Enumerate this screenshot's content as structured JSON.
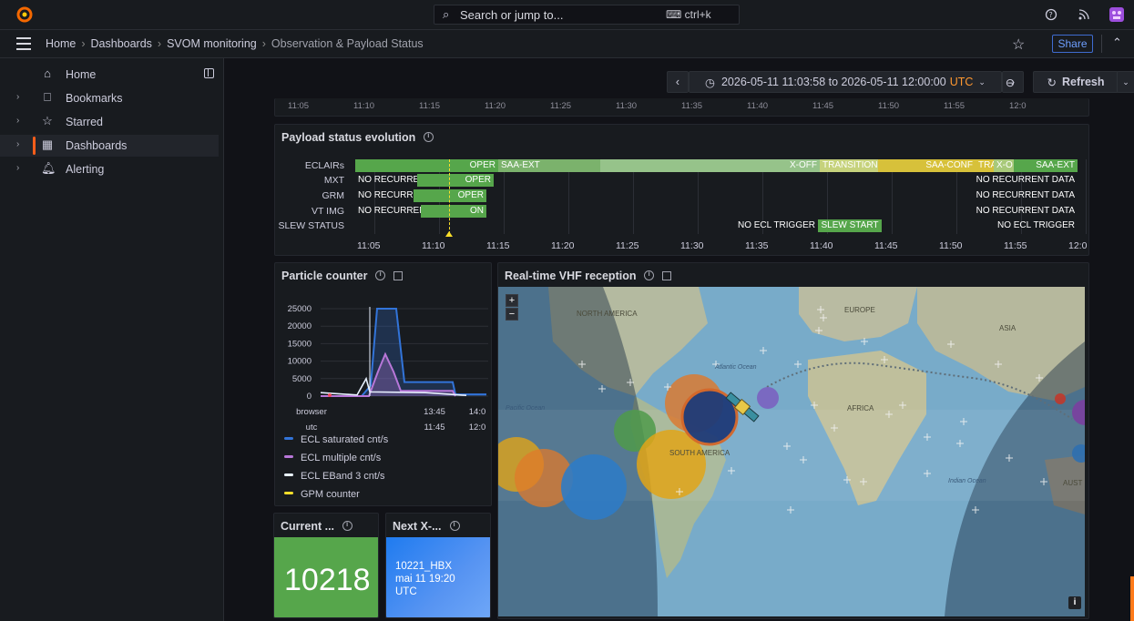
{
  "topbar": {
    "search_placeholder": "Search or jump to...",
    "search_shortcut": "ctrl+k",
    "icons": [
      "grafana-logo",
      "help-icon",
      "rss-icon",
      "user-avatar"
    ]
  },
  "breadcrumb": {
    "items": [
      "Home",
      "Dashboards",
      "SVOM monitoring",
      "Observation & Payload Status"
    ],
    "share_label": "Share"
  },
  "sidebar": {
    "items": [
      {
        "label": "Home",
        "icon": "home-icon"
      },
      {
        "label": "Bookmarks",
        "icon": "bookmark-icon"
      },
      {
        "label": "Starred",
        "icon": "star-icon"
      },
      {
        "label": "Dashboards",
        "icon": "dashboards-icon"
      },
      {
        "label": "Alerting",
        "icon": "bell-icon"
      }
    ]
  },
  "timepicker": {
    "range": "2026-05-11 11:03:58 to 2026-05-11 12:00:00",
    "tz": "UTC",
    "refresh_label": "Refresh"
  },
  "top_axis": {
    "ticks": [
      "11:05",
      "11:10",
      "11:15",
      "11:20",
      "11:25",
      "11:30",
      "11:35",
      "11:40",
      "11:45",
      "11:50",
      "11:55",
      "12:0"
    ]
  },
  "payload_panel": {
    "title": "Payload status evolution",
    "rows": [
      "ECLAIRs",
      "MXT",
      "GRM",
      "VT IMG",
      "SLEW STATUS"
    ],
    "segments": {
      "eclairs": [
        "OPER",
        "SAA-EXT",
        "X-OFF",
        "TRANSITION",
        "SAA-CONF",
        "TRA",
        "X-O",
        "SAA-EXT"
      ],
      "mxt": [
        "NO RECURREN",
        "OPER",
        "NO RECURRENT DATA"
      ],
      "grm": [
        "NO RECURREN",
        "OPER",
        "NO RECURRENT DATA"
      ],
      "vtimg": [
        "NO RECURREN",
        "ON",
        "NO RECURRENT DATA"
      ],
      "slew": [
        "NO ECL TRIGGER",
        "SLEW START",
        "NO ECL TRIGGER"
      ]
    },
    "ticks": [
      "11:05",
      "11:10",
      "11:15",
      "11:20",
      "11:25",
      "11:30",
      "11:35",
      "11:40",
      "11:45",
      "11:50",
      "11:55",
      "12:0"
    ]
  },
  "particle_panel": {
    "title": "Particle counter",
    "y_ticks": [
      "25000",
      "20000",
      "15000",
      "10000",
      "5000",
      "0"
    ],
    "x_rows": [
      {
        "label": "browser",
        "ticks": [
          "13:45",
          "14:0"
        ]
      },
      {
        "label": "utc",
        "ticks": [
          "11:45",
          "12:0"
        ]
      }
    ],
    "legend": [
      {
        "name": "ECL saturated cnt/s",
        "color": "#3274d9"
      },
      {
        "name": "ECL multiple cnt/s",
        "color": "#b877d9"
      },
      {
        "name": "ECL EBand 3 cnt/s",
        "color": "#e8f1ff"
      },
      {
        "name": "GPM counter",
        "color": "#fade2a"
      }
    ]
  },
  "stat_current": {
    "title": "Current ...",
    "value": "10218"
  },
  "stat_next": {
    "title": "Next X-...",
    "line1": "10221_HBX",
    "line2": "mai 11 19:20",
    "line3": "UTC"
  },
  "map_panel": {
    "title": "Real-time VHF reception",
    "labels": {
      "north_america": "NORTH AMERICA",
      "europe": "EUROPE",
      "asia": "ASIA",
      "africa": "AFRICA",
      "south_america": "SOUTH AMERICA",
      "atlantic": "Atlantic Ocean",
      "pacific": "Pacific Ocean",
      "indian": "Indian Ocean",
      "australia": "AUST"
    },
    "zoom_in": "+",
    "zoom_out": "−",
    "info": "i"
  }
}
